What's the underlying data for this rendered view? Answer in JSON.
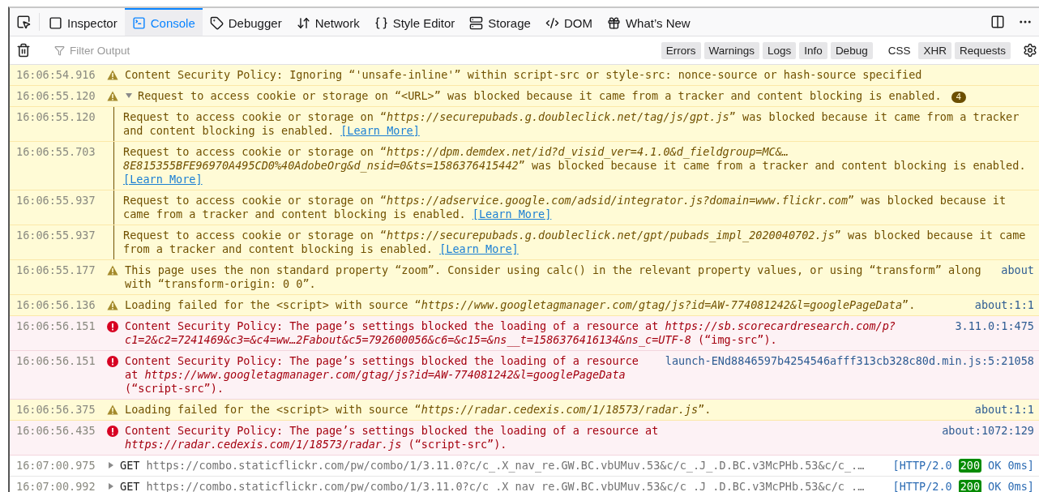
{
  "toolbar": {
    "tabs": [
      {
        "kind": "inspector",
        "label": "Inspector",
        "selected": false
      },
      {
        "kind": "console",
        "label": "Console",
        "selected": true
      },
      {
        "kind": "debugger",
        "label": "Debugger",
        "selected": false
      },
      {
        "kind": "network",
        "label": "Network",
        "selected": false
      },
      {
        "kind": "style",
        "label": "Style Editor",
        "selected": false
      },
      {
        "kind": "storage",
        "label": "Storage",
        "selected": false
      },
      {
        "kind": "dom",
        "label": "DOM",
        "selected": false
      },
      {
        "kind": "new",
        "label": "What’s New",
        "selected": false
      }
    ]
  },
  "filter_bar": {
    "placeholder": "Filter Output",
    "levels": [
      {
        "label": "Errors",
        "selected": true
      },
      {
        "label": "Warnings",
        "selected": true
      },
      {
        "label": "Logs",
        "selected": true
      },
      {
        "label": "Info",
        "selected": true
      },
      {
        "label": "Debug",
        "selected": true
      }
    ],
    "extras": [
      {
        "label": "CSS",
        "selected": false
      },
      {
        "label": "XHR",
        "selected": true
      },
      {
        "label": "Requests",
        "selected": true
      }
    ]
  },
  "messages": [
    {
      "kind": "warning",
      "time": "16:06:54.916",
      "text": "Content Security Policy: Ignoring “'unsafe-inline'” within script-src or style-src: nonce-source or hash-source specified"
    },
    {
      "kind": "warning",
      "time": "16:06:55.120",
      "text": "Request to access cookie or storage on “<URL>” was blocked because it came from a tracker and content blocking is enabled.",
      "expanded": true,
      "count": "4",
      "children": [
        {
          "time": "16:06:55.120",
          "text": "Request to access cookie or storage on “*https://securepubads.g.doubleclick.net/tag/js/gpt.js*” was blocked because it came from a tracker and content blocking is enabled.",
          "link": "[Learn More]"
        },
        {
          "time": "16:06:55.703",
          "text": "Request to access cookie or storage on “*https://dpm.demdex.net/id?d_visid_ver=4.1.0&d_fieldgroup=MC&…8E815355BFE96970A495CD0%40AdobeOrg&d_nsid=0&ts=1586376415442*” was blocked because it came from a tracker and content blocking is enabled.",
          "link": "[Learn More]"
        },
        {
          "time": "16:06:55.937",
          "text": "Request to access cookie or storage on “*https://adservice.google.com/adsid/integrator.js?domain=www.flickr.com*” was blocked because it came from a tracker and content blocking is enabled.",
          "link": "[Learn More]"
        },
        {
          "time": "16:06:55.937",
          "text": "Request to access cookie or storage on “*https://securepubads.g.doubleclick.net/gpt/pubads_impl_2020040702.js*” was blocked because it came from a tracker and content blocking is enabled.",
          "link": "[Learn More]"
        }
      ]
    },
    {
      "kind": "warning",
      "time": "16:06:55.177",
      "text": "This page uses the non standard property “zoom”. Consider using calc() in the relevant property values, or using “transform” along with “transform-origin: 0 0”.",
      "source": "about"
    },
    {
      "kind": "warning",
      "time": "16:06:56.136",
      "text": "Loading failed for the <script> with source “*https://www.googletagmanager.com/gtag/js?id=AW-774081242&l=googlePageData*”.",
      "source": "about:1:1"
    },
    {
      "kind": "error",
      "time": "16:06:56.151",
      "text": "Content Security Policy: The page’s settings blocked the loading of a resource at *https://sb.scorecardresearch.com/p?c1=2&c2=7241469&c3=&c4=ww…2Fabout&c5=792600056&c6=&c15=&ns__t=1586376416134&ns_c=UTF-8* (“img-src”).",
      "source": "3.11.0:1:475"
    },
    {
      "kind": "error",
      "time": "16:06:56.151",
      "text": "Content Security Policy: The page’s settings blocked the loading of a resource at *https://www.googletagmanager.com/gtag/js?id=AW-774081242&l=googlePageData* (“script-src”).",
      "source": "launch-ENd8846597b4254546afff313cb328c80d.min.js:5:21058"
    },
    {
      "kind": "warning",
      "time": "16:06:56.375",
      "text": "Loading failed for the <script> with source “*https://radar.cedexis.com/1/18573/radar.js*”.",
      "source": "about:1:1"
    },
    {
      "kind": "error",
      "time": "16:06:56.435",
      "text": "Content Security Policy: The page’s settings blocked the loading of a resource at *https://radar.cedexis.com/1/18573/radar.js* (“script-src”).",
      "source": "about:1072:129"
    },
    {
      "kind": "network",
      "time": "16:07:00.975",
      "method": "GET",
      "url": "https://combo.staticflickr.com/pw/combo/1/3.11.0?c/c_.X_nav_re.GW.BC.vbUMuv.53&c/c_.J_.D.BC.v3McPHb.53&c/c_.…",
      "protocol": "[HTTP/2.0",
      "status": "200",
      "result": "OK 0ms]"
    },
    {
      "kind": "network",
      "time": "16:07:00.992",
      "method": "GET",
      "url": "https://combo.staticflickr.com/pw/combo/1/3.11.0?c/c_.X_nav_re.GW.BC.vbUMuv.53&c/c_.J_.D.BC.v3McPHb.53&c/c_.…",
      "protocol": "[HTTP/2.0",
      "status": "200",
      "result": "OK 0ms]"
    }
  ]
}
